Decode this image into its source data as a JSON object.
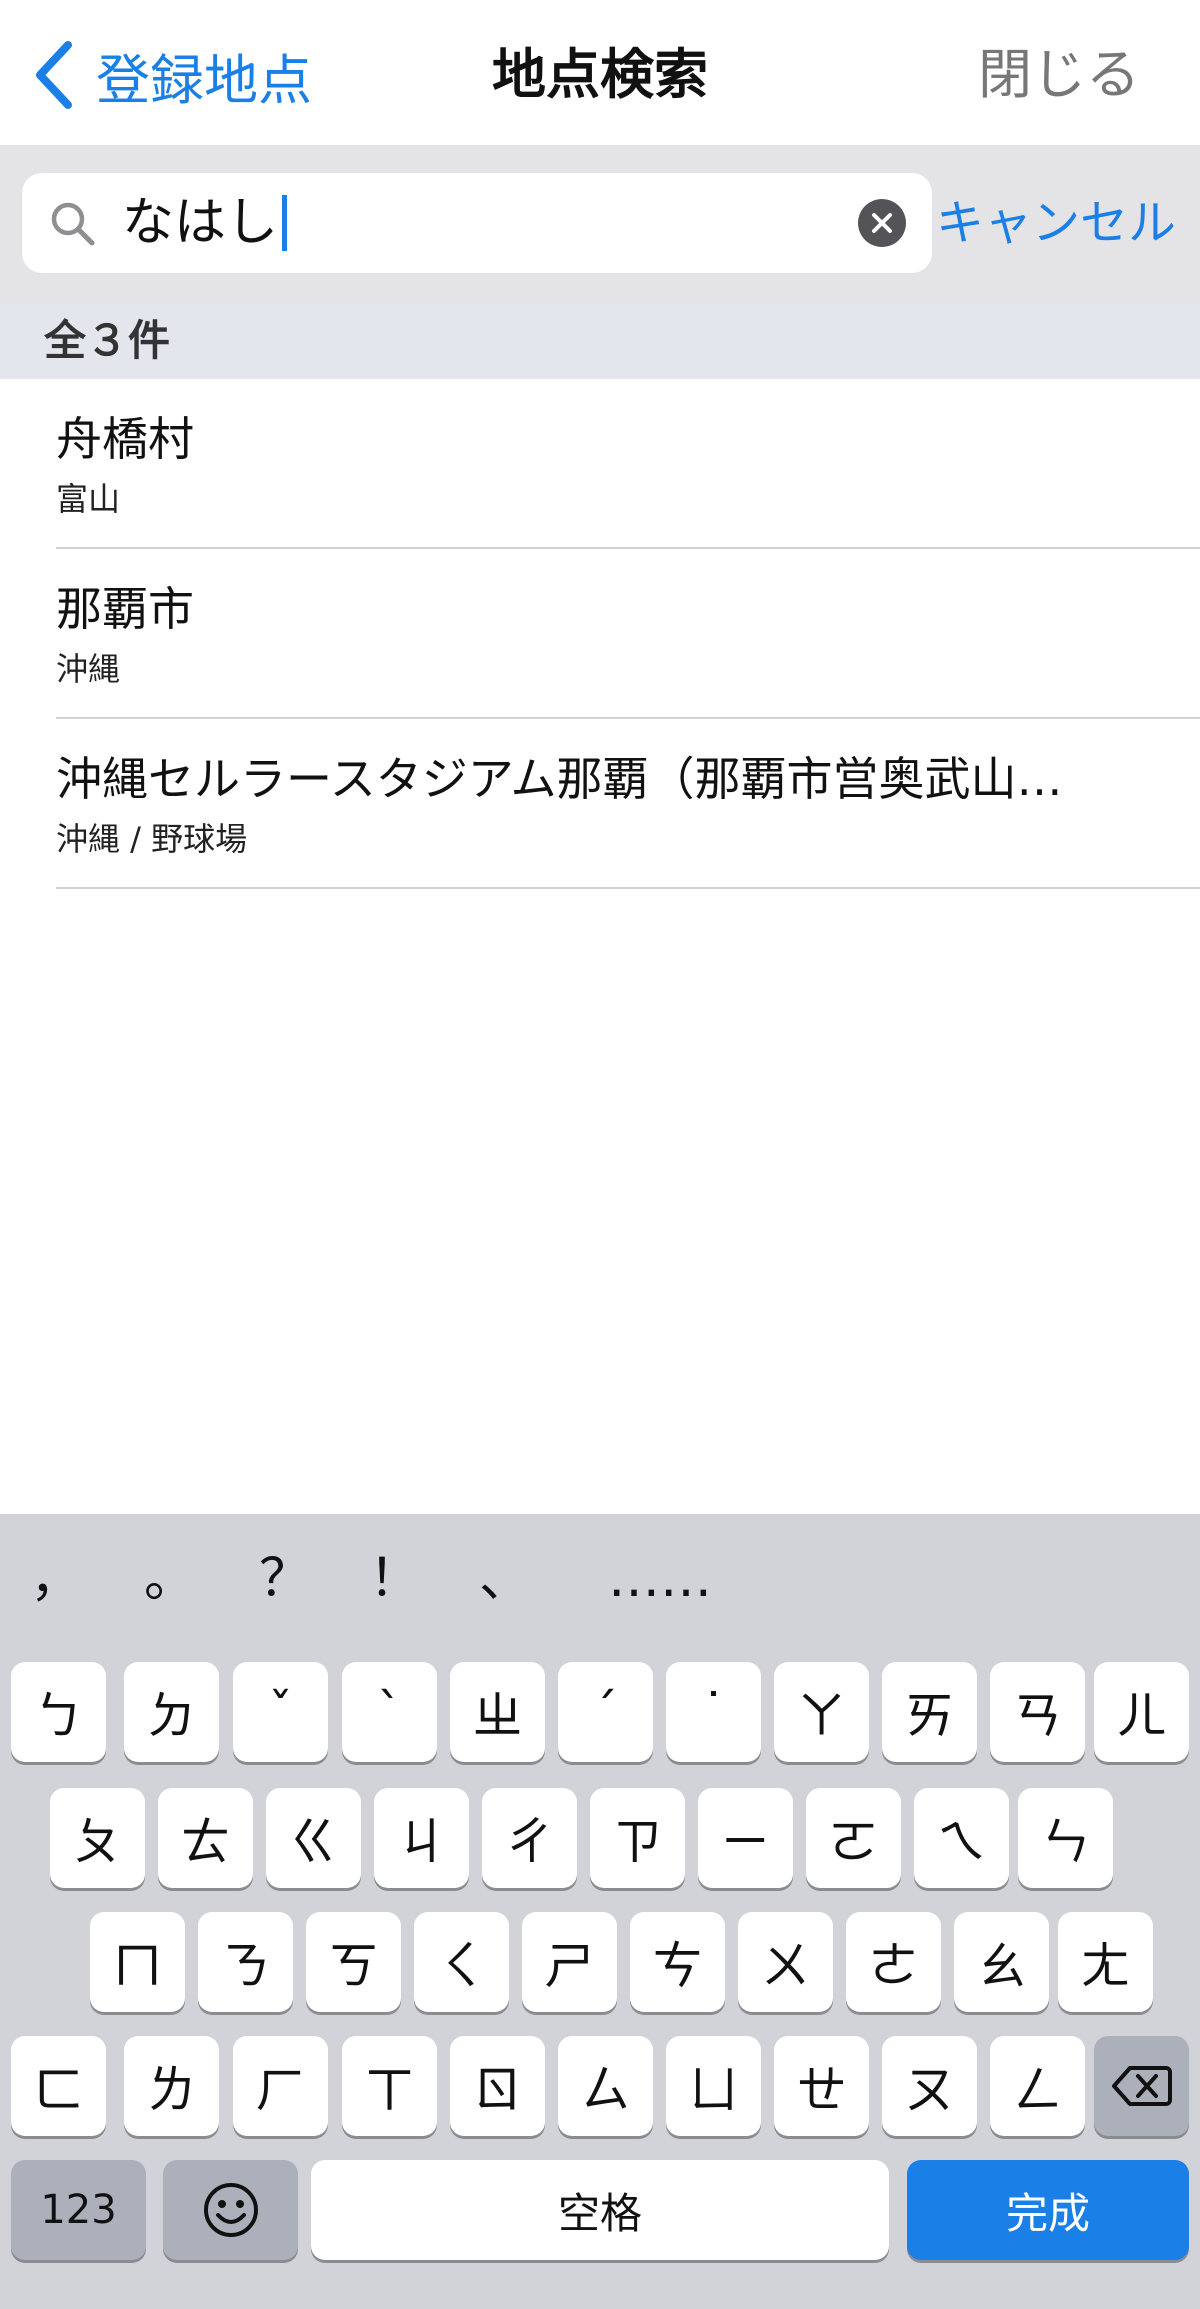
{
  "nav": {
    "back_label": "登録地点",
    "title": "地点検索",
    "close_label": "閉じる"
  },
  "search": {
    "query": "なはし",
    "cancel_label": "キャンセル"
  },
  "results_header": "全３件",
  "results": [
    {
      "title": "舟橋村",
      "subtitle": "富山"
    },
    {
      "title": "那覇市",
      "subtitle": "沖縄"
    },
    {
      "title": "沖縄セルラースタジアム那覇（那覇市営奥武山…",
      "subtitle": "沖縄 / 野球場"
    }
  ],
  "keyboard": {
    "punctuation": [
      "，",
      "。",
      "？",
      "！",
      "、",
      "……"
    ],
    "row1": [
      "ㄅ",
      "ㄉ",
      "ˇ",
      "ˋ",
      "ㄓ",
      "ˊ",
      "˙",
      "ㄚ",
      "ㄞ",
      "ㄢ",
      "ㄦ"
    ],
    "row2": [
      "ㄆ",
      "ㄊ",
      "ㄍ",
      "ㄐ",
      "ㄔ",
      "ㄗ",
      "ㄧ",
      "ㄛ",
      "ㄟ",
      "ㄣ"
    ],
    "row3": [
      "ㄇ",
      "ㄋ",
      "ㄎ",
      "ㄑ",
      "ㄕ",
      "ㄘ",
      "ㄨ",
      "ㄜ",
      "ㄠ",
      "ㄤ"
    ],
    "row4": [
      "ㄈ",
      "ㄌ",
      "ㄏ",
      "ㄒ",
      "ㄖ",
      "ㄙ",
      "ㄩ",
      "ㄝ",
      "ㄡ",
      "ㄥ"
    ],
    "numbers_label": "123",
    "emoji_icon": "smiley-face-icon",
    "space_label": "空格",
    "done_label": "完成",
    "delete_icon": "backspace-icon"
  },
  "colors": {
    "accent": "#1a7fe6",
    "search_bg": "#e4e4e6",
    "section_bg": "#e4e6ee",
    "keyboard_bg": "#d1d3d9"
  }
}
